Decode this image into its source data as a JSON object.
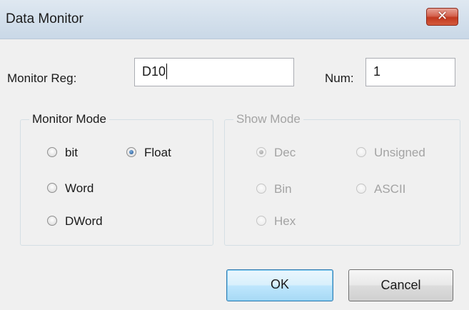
{
  "window": {
    "title": "Data Monitor",
    "close_symbol": "✕"
  },
  "monitor_reg": {
    "label": "Monitor Reg:",
    "value": "D10"
  },
  "num": {
    "label": "Num:",
    "value": "1"
  },
  "monitor_mode": {
    "title": "Monitor Mode",
    "options": [
      {
        "label": "bit",
        "checked": false
      },
      {
        "label": "Float",
        "checked": true
      },
      {
        "label": "Word",
        "checked": false
      },
      {
        "label": "DWord",
        "checked": false
      }
    ]
  },
  "show_mode": {
    "title": "Show Mode",
    "enabled": false,
    "options": [
      {
        "label": "Dec",
        "checked": true
      },
      {
        "label": "Unsigned",
        "checked": false
      },
      {
        "label": "Bin",
        "checked": false
      },
      {
        "label": "ASCII",
        "checked": false
      },
      {
        "label": "Hex",
        "checked": false
      }
    ]
  },
  "buttons": {
    "ok": "OK",
    "cancel": "Cancel"
  }
}
